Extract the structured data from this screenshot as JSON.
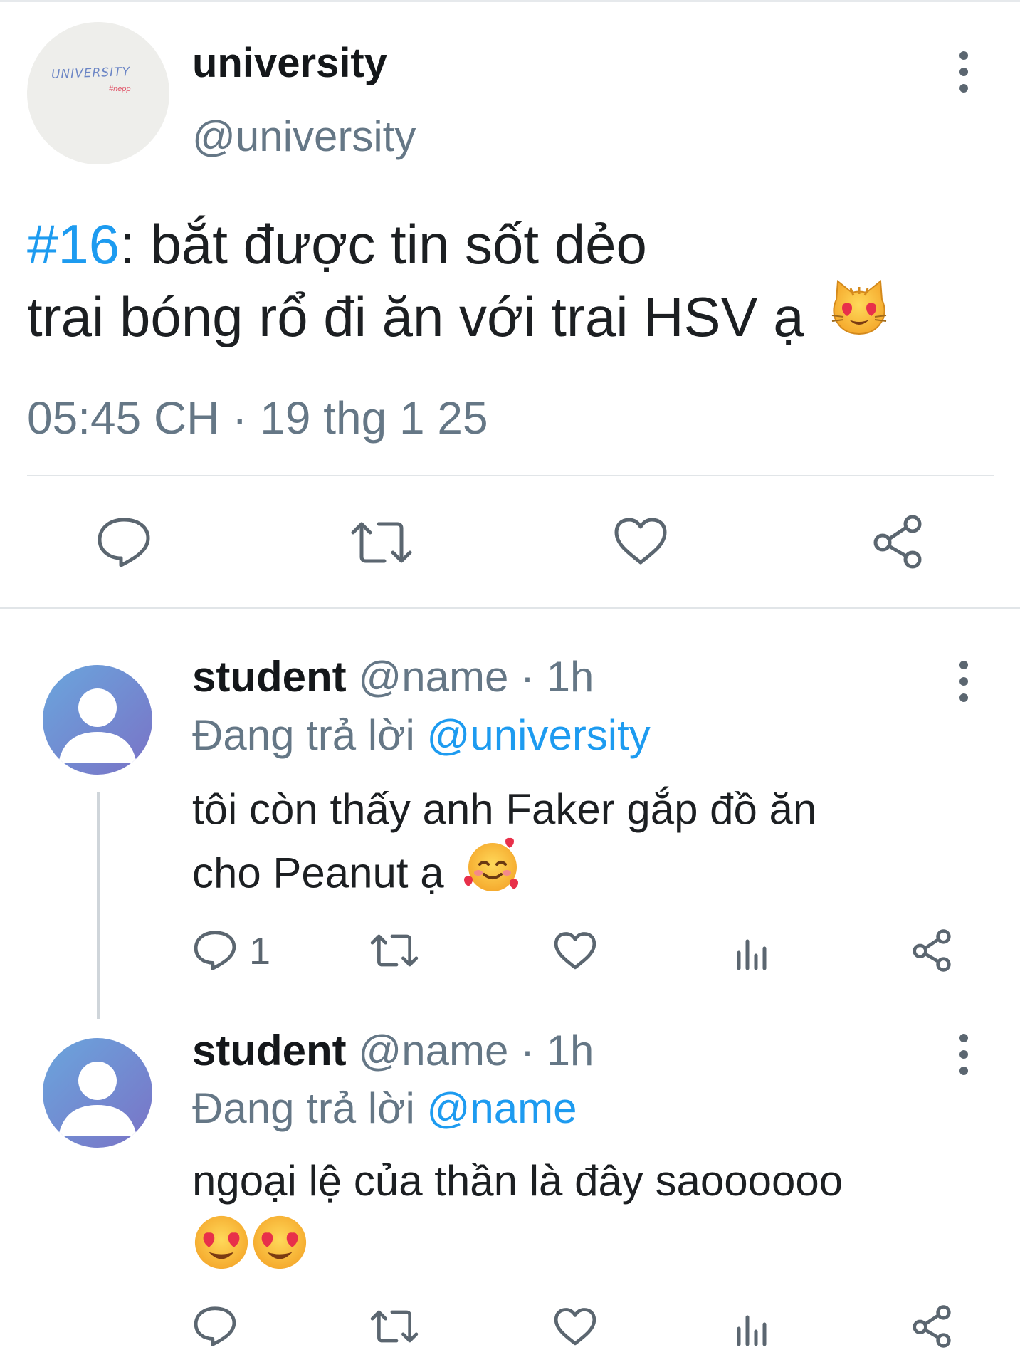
{
  "tweet": {
    "display_name": "university",
    "handle": "@university",
    "avatar_text_main": "UNIVERSITY",
    "avatar_text_sub": "#nepp",
    "hashtag": "#16",
    "line1_rest": ": bắt được tin sốt dẻo",
    "line2": "trai bóng rổ đi ăn với trai HSV ạ",
    "line2_emoji": "heart-eyes-cat",
    "time": "05:45 CH · 19 thg 1 25",
    "actions": [
      "reply-icon",
      "retweet-icon",
      "like-icon",
      "share-icon"
    ]
  },
  "replies": [
    {
      "display_name": "student",
      "meta": " @name · 1h",
      "replying_prefix": "Đang trả lời ",
      "replying_to": "@university",
      "line1": "tôi còn thấy anh Faker gắp đồ ăn",
      "line2": "cho Peanut ạ",
      "line2_emoji": "smiling-face-with-hearts",
      "reply_count": "1",
      "actions": [
        "reply-icon",
        "retweet-icon",
        "like-icon",
        "views-icon",
        "share-icon"
      ]
    },
    {
      "display_name": "student",
      "meta": " @name · 1h",
      "replying_prefix": "Đang trả lời ",
      "replying_to": "@name",
      "line1": "ngoại lệ của thần là đây saoooooo",
      "line2_emoji": "heart-eyes x2",
      "actions": [
        "reply-icon",
        "retweet-icon",
        "like-icon",
        "views-icon",
        "share-icon"
      ]
    }
  ],
  "colors": {
    "link": "#1d9bf0",
    "secondary_text": "#657786",
    "icon": "#5b6670",
    "divider": "#e1e5e8",
    "avatar_gradient": [
      "#6aa6dd",
      "#7a72c6"
    ]
  }
}
